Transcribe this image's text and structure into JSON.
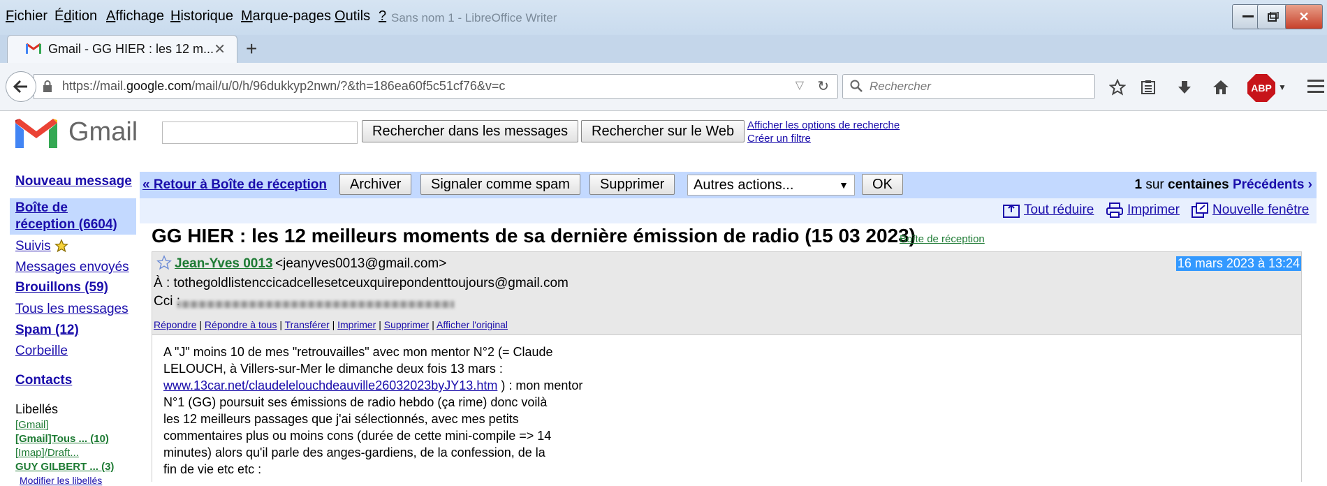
{
  "menu": [
    "Fichier",
    "Édition",
    "Affichage",
    "Historique",
    "Marque-pages",
    "Outils",
    "?"
  ],
  "menu_underline": [
    "F",
    "d",
    "A",
    "H",
    "M",
    "O",
    "?"
  ],
  "window_ghost_title": "Sans nom 1 - LibreOffice Writer",
  "tab": {
    "title": "Gmail - GG HIER : les 12 m...",
    "close": "✕",
    "new_tab": "+"
  },
  "navbar": {
    "url_prefix": "https://mail.",
    "url_domain": "google.com",
    "url_rest": "/mail/u/0/h/96dukkyp2nwn/?&th=186ea60f5c51cf76&v=c",
    "search_placeholder": "Rechercher",
    "abp_label": "ABP"
  },
  "gmail": {
    "wordmark": "Gmail",
    "search_mail_button": "Rechercher dans les messages",
    "search_web_button": "Rechercher sur le Web",
    "show_search_options": "Afficher les options de recherche",
    "create_filter": "Créer un filtre"
  },
  "sidebar": {
    "compose": "Nouveau message",
    "inbox_line1": "Boîte de",
    "inbox_line2": "réception (6604)",
    "starred": "Suivis",
    "sent": "Messages envoyés",
    "drafts": "Brouillons (59)",
    "all_mail": "Tous les messages",
    "spam": "Spam (12)",
    "trash": "Corbeille",
    "contacts": "Contacts",
    "labels_heading": "Libellés",
    "labels": [
      "[Gmail]",
      "[Gmail]Tous ... (10)",
      "[Imap]/Draft...",
      "GUY GILBERT ... (3)"
    ],
    "edit_labels": "Modifier les libellés"
  },
  "actionbar": {
    "back_to_inbox": "« Retour à Boîte de réception",
    "archive": "Archiver",
    "report_spam": "Signaler comme spam",
    "delete": "Supprimer",
    "more_actions": "Autres actions...",
    "ok": "OK",
    "pager_count": "1",
    "pager_mid": " sur ",
    "pager_total": "centaines",
    "pager_prev": "Précédents ›"
  },
  "subbar": {
    "collapse_all": "Tout réduire",
    "print": "Imprimer",
    "new_window": "Nouvelle fenêtre"
  },
  "message": {
    "subject": "GG HIER : les 12 meilleurs moments de sa dernière émission de radio (15 03 2023)",
    "label": "Boîte de réception",
    "sender_name": "Jean-Yves 0013",
    "sender_email": "<jeanyves0013@gmail.com>",
    "date": "16 mars 2023 à 13:24",
    "to": "À : tothegoldlistenccicadcellesetceuxquirepondenttoujours@gmail.com",
    "cc": "Cci :",
    "actions": [
      "Répondre",
      "Répondre à tous",
      "Transférer",
      "Imprimer",
      "Supprimer",
      "Afficher l'original"
    ],
    "body_lines": [
      "A \"J\" moins 10 de mes \"retrouvailles\" avec mon mentor N°2 (= Claude",
      "LELOUCH, à Villers-sur-Mer le dimanche deux fois 13 mars :"
    ],
    "body_link": "www.13car.net/claudelelouchdeauville26032023byJY13.htm",
    "body_link_after": " ) : mon mentor",
    "body_lines_after": [
      "N°1 (GG) poursuit ses émissions de radio hebdo (ça rime) donc voilà",
      "les 12 meilleurs passages que j'ai sélectionnés, avec mes petits",
      "commentaires plus ou moins cons  (durée de cette mini-compile =>  14",
      "minutes) alors qu'il parle des anges-gardiens, de la confession, de la",
      "fin de vie etc etc :"
    ]
  },
  "colors": {
    "menubar": "#c9dbee",
    "gmail_selected": "#c3d9ff",
    "link": "#1a0dab",
    "label_green": "#1e7b34",
    "date_highlight": "#3399ff"
  }
}
